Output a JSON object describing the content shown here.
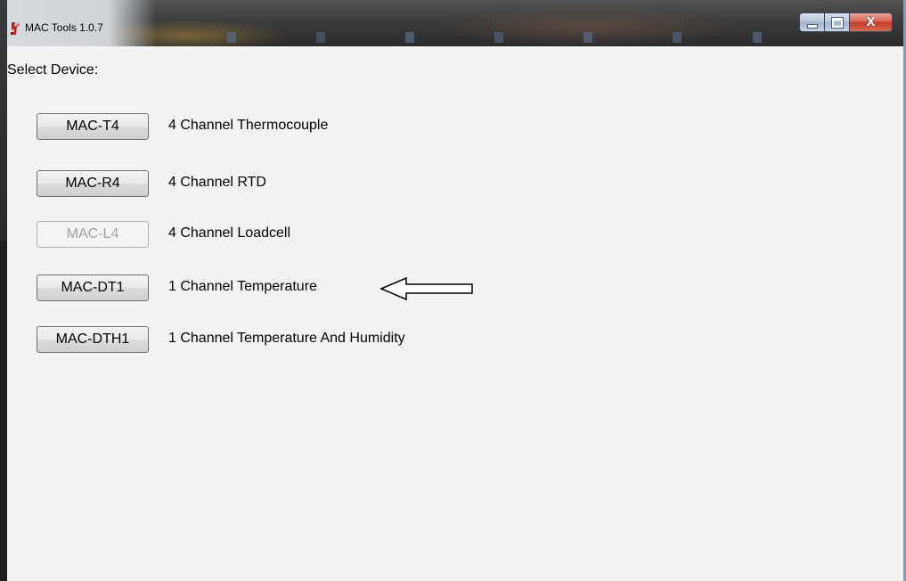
{
  "window": {
    "title": "MAC Tools 1.0.7",
    "controls": {
      "minimize_icon": "minimize-icon",
      "maximize_icon": "maximize-icon",
      "close_label": "X"
    }
  },
  "main": {
    "select_label": "Select Device:",
    "devices": [
      {
        "button_label": "MAC-T4",
        "description": "4 Channel Thermocouple",
        "enabled": true
      },
      {
        "button_label": "MAC-R4",
        "description": "4 Channel RTD",
        "enabled": true
      },
      {
        "button_label": "MAC-L4",
        "description": "4 Channel Loadcell",
        "enabled": false
      },
      {
        "button_label": "MAC-DT1",
        "description": "1 Channel Temperature",
        "enabled": true
      },
      {
        "button_label": "MAC-DTH1",
        "description": "1 Channel Temperature And Humidity",
        "enabled": true
      }
    ],
    "pointer_icon": "left-arrow-icon"
  },
  "colors": {
    "client_background": "#f3f3f3",
    "disabled_text": "#a0a0a0",
    "close_button": "#c43a2b"
  }
}
